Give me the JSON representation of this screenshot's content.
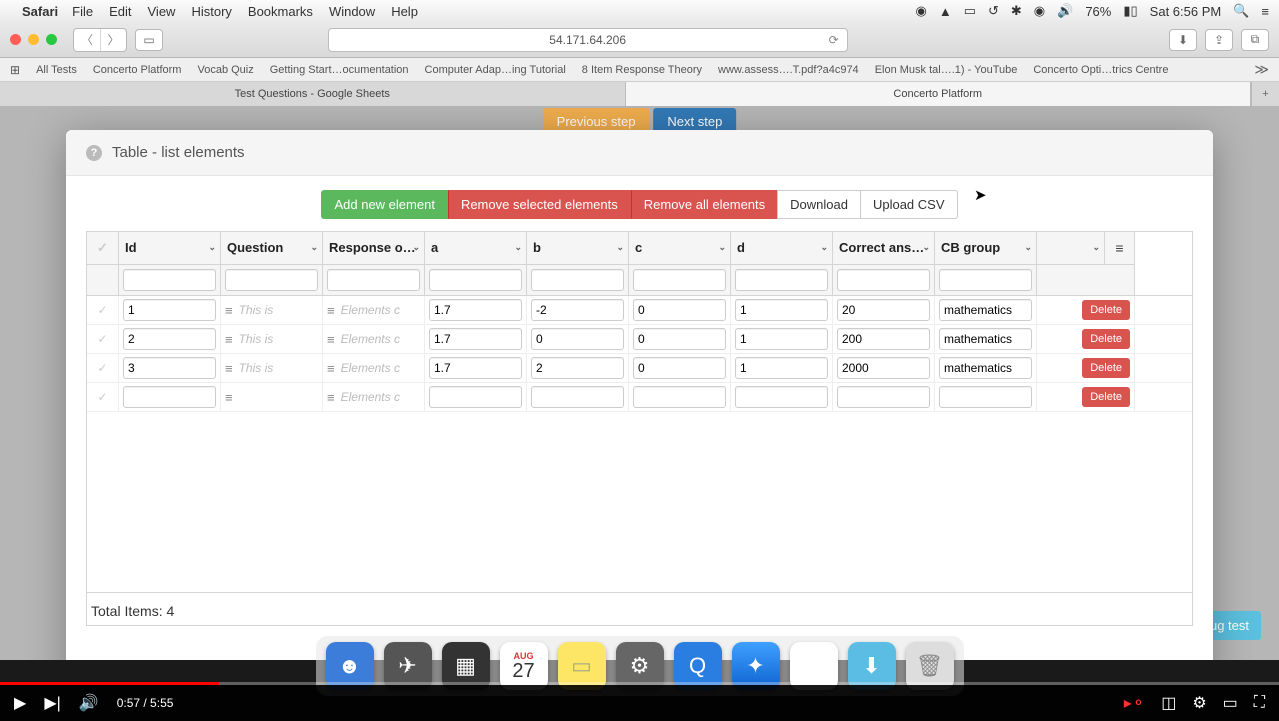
{
  "menubar": {
    "app": "Safari",
    "items": [
      "File",
      "Edit",
      "View",
      "History",
      "Bookmarks",
      "Window",
      "Help"
    ],
    "battery": "76%",
    "clock": "Sat 6:56 PM"
  },
  "toolbar": {
    "url": "54.171.64.206"
  },
  "favorites": [
    "All Tests",
    "Concerto Platform",
    "Vocab Quiz",
    "Getting Start…ocumentation",
    "Computer Adap…ing Tutorial",
    "8 Item Response Theory",
    "www.assess….T.pdf?a4c974",
    "Elon Musk tal….1) - YouTube",
    "Concerto Opti…trics Centre"
  ],
  "tabs": {
    "left": "Test Questions - Google Sheets",
    "right": "Concerto Platform"
  },
  "steps": {
    "prev": "Previous step",
    "next": "Next step"
  },
  "debug": "ug test",
  "modal": {
    "title": "Table - list elements",
    "actions": {
      "add": "Add new element",
      "remove_sel": "Remove selected elements",
      "remove_all": "Remove all elements",
      "download": "Download",
      "upload": "Upload CSV"
    },
    "columns": [
      "Id",
      "Question",
      "Response o…",
      "a",
      "b",
      "c",
      "d",
      "Correct ans…",
      "CB group"
    ],
    "question_placeholder": "<p>This is",
    "response_placeholder": "Elements c",
    "delete_label": "Delete",
    "rows": [
      {
        "id": "1",
        "a": "1.7",
        "b": "-2",
        "c": "0",
        "d": "1",
        "ans": "20",
        "cb": "mathematics"
      },
      {
        "id": "2",
        "a": "1.7",
        "b": "0",
        "c": "0",
        "d": "1",
        "ans": "200",
        "cb": "mathematics"
      },
      {
        "id": "3",
        "a": "1.7",
        "b": "2",
        "c": "0",
        "d": "1",
        "ans": "2000",
        "cb": "mathematics"
      },
      {
        "id": "",
        "a": "",
        "b": "",
        "c": "",
        "d": "",
        "ans": "",
        "cb": ""
      }
    ],
    "total": "Total Items: 4"
  },
  "video": {
    "time": "0:57 / 5:55"
  }
}
